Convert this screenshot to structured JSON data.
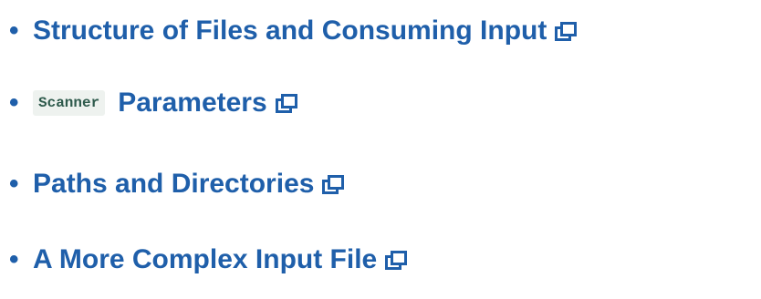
{
  "links": [
    {
      "label": "Structure of Files and Consuming Input",
      "icon": "open-in-new-icon"
    },
    {
      "code": "Scanner",
      "label": "Parameters",
      "icon": "open-in-new-icon"
    },
    {
      "label": "Paths and Directories",
      "icon": "open-in-new-icon"
    },
    {
      "label": "A More Complex Input File",
      "icon": "open-in-new-icon"
    }
  ],
  "bullet": "•",
  "colors": {
    "link": "#1f5faa",
    "code_text": "#2e5a4c",
    "code_background": "#eef2ef"
  }
}
